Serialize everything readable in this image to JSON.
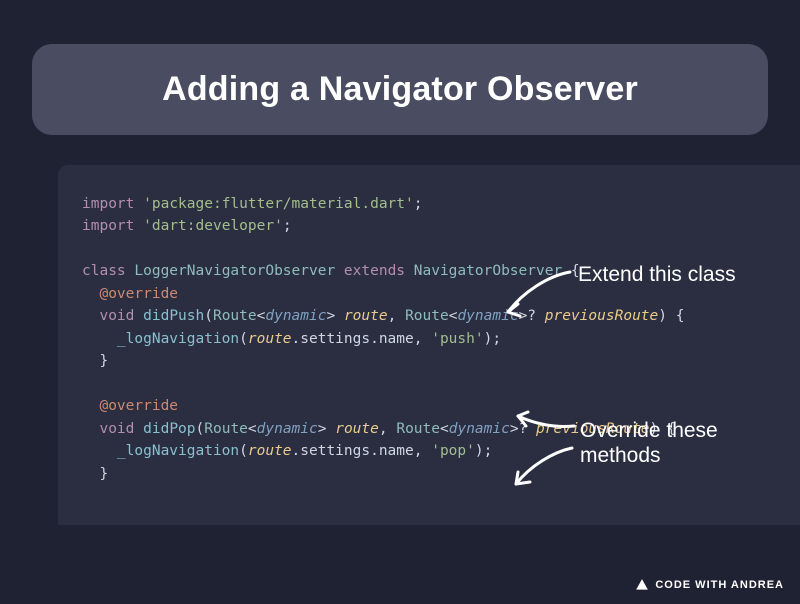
{
  "title": "Adding a Navigator Observer",
  "annotations": {
    "extend": "Extend this class",
    "override": "Override these\nmethods"
  },
  "code": {
    "import_kw": "import",
    "import1": "'package:flutter/material.dart'",
    "import2": "'dart:developer'",
    "class_kw": "class",
    "class_name": "LoggerNavigatorObserver",
    "extends_kw": "extends",
    "super_name": "NavigatorObserver",
    "override": "@override",
    "void_kw": "void",
    "didPush": "didPush",
    "didPop": "didPop",
    "route_type": "Route",
    "dynamic": "dynamic",
    "route_param": "route",
    "prev_param": "previousRoute",
    "log_fn": "_logNavigation",
    "route_expr_a": "route",
    "route_expr_b": ".settings.name, ",
    "push_str": "'push'",
    "pop_str": "'pop'"
  },
  "brand": {
    "name": "CODE WITH ANDREA"
  }
}
